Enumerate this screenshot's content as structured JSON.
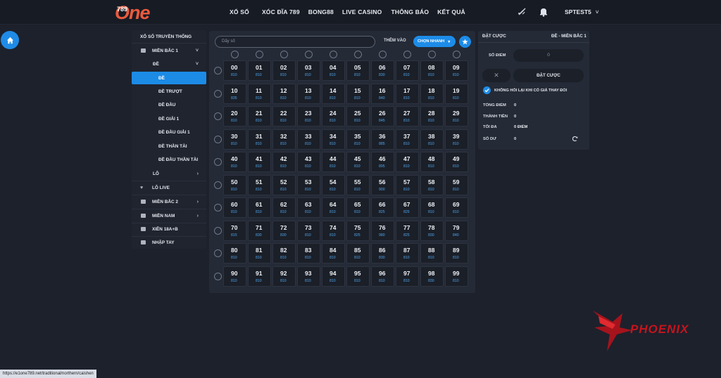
{
  "header": {
    "logo_number": "789",
    "logo_text": "One",
    "nav": [
      "XỔ SỐ",
      "XÓC ĐĨA 789",
      "BONG88",
      "LIVE CASINO",
      "THÔNG BÁO",
      "KẾT QUẢ"
    ],
    "username": "SPTEST5",
    "icons": [
      "mute-icon",
      "bell-icon",
      "chevron-down-icon"
    ]
  },
  "sidebar": {
    "section_title": "XỔ SỐ TRUYỀN THỐNG",
    "items": [
      {
        "label": "MIỀN BẮC 1",
        "icon": "grid-icon",
        "arrow": "˅"
      },
      {
        "label": "ĐỀ",
        "arrow": "˅"
      },
      {
        "label": "ĐỀ",
        "active": true
      },
      {
        "label": "ĐỀ TRƯỢT"
      },
      {
        "label": "ĐỀ ĐẦU"
      },
      {
        "label": "ĐỀ GIẢI 1"
      },
      {
        "label": "ĐỀ ĐẦU GIẢI 1"
      },
      {
        "label": "ĐỀ THẦN TÀI"
      },
      {
        "label": "ĐỀ ĐẦU THẦN TÀI"
      },
      {
        "label": "LÔ",
        "arrow": "›"
      },
      {
        "label": "LÔ LIVE",
        "icon": "heart-icon"
      },
      {
        "label": "MIỀN BẮC 2",
        "icon": "grid-icon",
        "arrow": "›"
      },
      {
        "label": "MIỀN NAM",
        "icon": "grid-icon",
        "arrow": "›"
      },
      {
        "label": "XIÊN 18A+B",
        "icon": "grid-icon"
      },
      {
        "label": "NHẬP TAY",
        "icon": "grid-icon"
      }
    ]
  },
  "toolbar": {
    "search_placeholder": "Dãy số",
    "add_label": "THÊM VÀO",
    "quick_select_label": "CHỌN NHANH"
  },
  "numbers": [
    {
      "n": "00",
      "p": "810"
    },
    {
      "n": "01",
      "p": "810"
    },
    {
      "n": "02",
      "p": "810"
    },
    {
      "n": "03",
      "p": "810"
    },
    {
      "n": "04",
      "p": "810"
    },
    {
      "n": "05",
      "p": "810"
    },
    {
      "n": "06",
      "p": "830"
    },
    {
      "n": "07",
      "p": "810"
    },
    {
      "n": "08",
      "p": "810"
    },
    {
      "n": "09",
      "p": "810"
    },
    {
      "n": "10",
      "p": "835"
    },
    {
      "n": "11",
      "p": "810"
    },
    {
      "n": "12",
      "p": "810"
    },
    {
      "n": "13",
      "p": "810"
    },
    {
      "n": "14",
      "p": "810"
    },
    {
      "n": "15",
      "p": "810"
    },
    {
      "n": "16",
      "p": "840"
    },
    {
      "n": "17",
      "p": "810"
    },
    {
      "n": "18",
      "p": "810"
    },
    {
      "n": "19",
      "p": "810"
    },
    {
      "n": "20",
      "p": "810"
    },
    {
      "n": "21",
      "p": "810"
    },
    {
      "n": "22",
      "p": "810"
    },
    {
      "n": "23",
      "p": "810"
    },
    {
      "n": "24",
      "p": "810"
    },
    {
      "n": "25",
      "p": "810"
    },
    {
      "n": "26",
      "p": "845"
    },
    {
      "n": "27",
      "p": "810"
    },
    {
      "n": "28",
      "p": "810"
    },
    {
      "n": "29",
      "p": "810"
    },
    {
      "n": "30",
      "p": "810"
    },
    {
      "n": "31",
      "p": "810"
    },
    {
      "n": "32",
      "p": "810"
    },
    {
      "n": "33",
      "p": "810"
    },
    {
      "n": "34",
      "p": "810"
    },
    {
      "n": "35",
      "p": "810"
    },
    {
      "n": "36",
      "p": "885"
    },
    {
      "n": "37",
      "p": "810"
    },
    {
      "n": "38",
      "p": "810"
    },
    {
      "n": "39",
      "p": "810"
    },
    {
      "n": "40",
      "p": "810"
    },
    {
      "n": "41",
      "p": "810"
    },
    {
      "n": "42",
      "p": "810"
    },
    {
      "n": "43",
      "p": "810"
    },
    {
      "n": "44",
      "p": "810"
    },
    {
      "n": "45",
      "p": "810"
    },
    {
      "n": "46",
      "p": "895"
    },
    {
      "n": "47",
      "p": "810"
    },
    {
      "n": "48",
      "p": "810"
    },
    {
      "n": "49",
      "p": "810"
    },
    {
      "n": "50",
      "p": "810"
    },
    {
      "n": "51",
      "p": "810"
    },
    {
      "n": "52",
      "p": "810"
    },
    {
      "n": "53",
      "p": "810"
    },
    {
      "n": "54",
      "p": "810"
    },
    {
      "n": "55",
      "p": "810"
    },
    {
      "n": "56",
      "p": "900"
    },
    {
      "n": "57",
      "p": "810"
    },
    {
      "n": "58",
      "p": "810"
    },
    {
      "n": "59",
      "p": "810"
    },
    {
      "n": "60",
      "p": "810"
    },
    {
      "n": "61",
      "p": "810"
    },
    {
      "n": "62",
      "p": "810"
    },
    {
      "n": "63",
      "p": "810"
    },
    {
      "n": "64",
      "p": "810"
    },
    {
      "n": "65",
      "p": "810"
    },
    {
      "n": "66",
      "p": "825"
    },
    {
      "n": "67",
      "p": "825"
    },
    {
      "n": "68",
      "p": "810"
    },
    {
      "n": "69",
      "p": "810"
    },
    {
      "n": "70",
      "p": "815"
    },
    {
      "n": "71",
      "p": "830"
    },
    {
      "n": "72",
      "p": "830"
    },
    {
      "n": "73",
      "p": "810"
    },
    {
      "n": "74",
      "p": "810"
    },
    {
      "n": "75",
      "p": "825"
    },
    {
      "n": "76",
      "p": "980"
    },
    {
      "n": "77",
      "p": "825"
    },
    {
      "n": "78",
      "p": "830"
    },
    {
      "n": "79",
      "p": "840"
    },
    {
      "n": "80",
      "p": "810"
    },
    {
      "n": "81",
      "p": "810"
    },
    {
      "n": "82",
      "p": "810"
    },
    {
      "n": "83",
      "p": "810"
    },
    {
      "n": "84",
      "p": "810"
    },
    {
      "n": "85",
      "p": "810"
    },
    {
      "n": "86",
      "p": "830"
    },
    {
      "n": "87",
      "p": "810"
    },
    {
      "n": "88",
      "p": "810"
    },
    {
      "n": "89",
      "p": "810"
    },
    {
      "n": "90",
      "p": "810"
    },
    {
      "n": "91",
      "p": "810"
    },
    {
      "n": "92",
      "p": "810"
    },
    {
      "n": "93",
      "p": "810"
    },
    {
      "n": "94",
      "p": "810"
    },
    {
      "n": "95",
      "p": "810"
    },
    {
      "n": "96",
      "p": "810"
    },
    {
      "n": "97",
      "p": "810"
    },
    {
      "n": "98",
      "p": "830"
    },
    {
      "n": "99",
      "p": "810"
    }
  ],
  "bet_panel": {
    "title": "ĐẶT CƯỢC",
    "subtitle": "ĐỀ - MIỀN BẮC 1",
    "points_label": "SỐ ĐIỂM",
    "points_value": "0",
    "clear_label": "✕",
    "bet_label": "ĐẶT CƯỢC",
    "confirm_label": "KHÔNG HỎI LẠI KHI CÓ GIÁ THAY ĐỔI",
    "total_points_label": "TỔNG ĐIỂM",
    "total_points_value": "0",
    "amount_label": "THÀNH TIỀN",
    "amount_value": "0",
    "max_label": "TỐI ĐA",
    "max_value": "0 ĐIỂM",
    "balance_label": "SỐ DƯ",
    "balance_value": "0"
  },
  "watermark": "PHOENIX",
  "status_url": "https://e1one789.net/traditional/northern/caishen",
  "colors": {
    "accent": "#1d8ce8",
    "logo": "#ea5a3d",
    "watermark": "#c5141d"
  }
}
